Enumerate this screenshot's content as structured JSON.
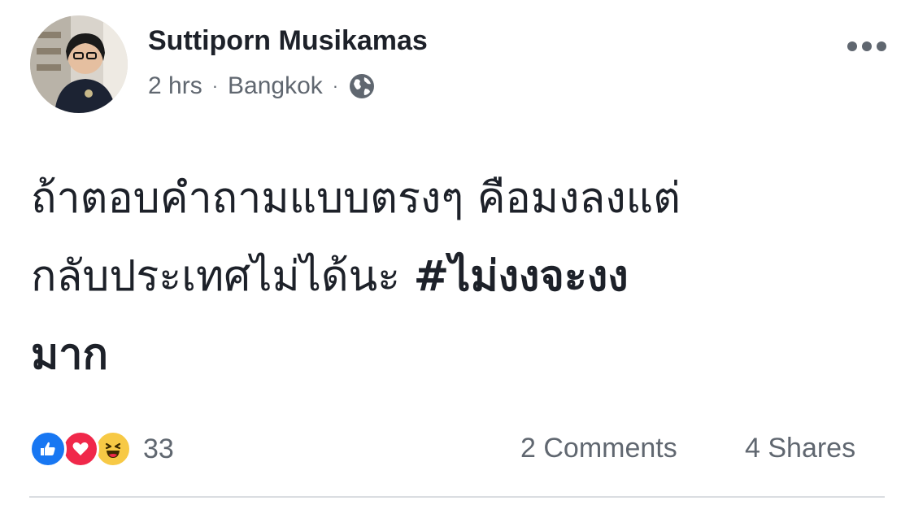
{
  "post": {
    "author_name": "Suttiporn Musikamas",
    "time": "2 hrs",
    "separator": "·",
    "location": "Bangkok",
    "privacy_icon": "globe-icon",
    "text_line_1": "ถ้าตอบคำถามแบบตรงๆ คือมงลงแต่",
    "text_line_2_plain": "กลับประเทศไม่ได้นะ ",
    "text_line_2_hashtag": "#ไม่งงจะงง",
    "text_line_3_hashtag": "มาก"
  },
  "footer": {
    "reaction_icons": [
      "like-icon",
      "love-icon",
      "haha-icon"
    ],
    "reaction_count": "33",
    "comments": "2 Comments",
    "shares": "4 Shares"
  },
  "colors": {
    "text_primary": "#1d2129",
    "text_secondary": "#606770",
    "like": "#1877f2",
    "love": "#f0284a",
    "haha": "#f7c945",
    "divider": "#dadde1"
  }
}
